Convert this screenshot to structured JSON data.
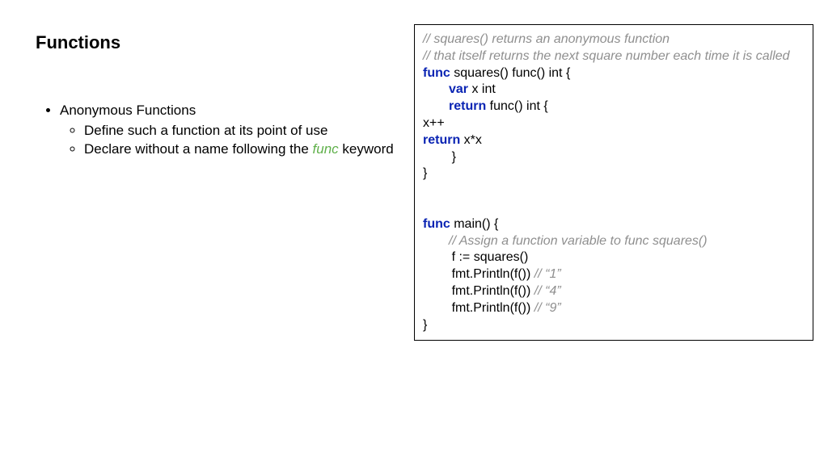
{
  "title": "Functions",
  "bullets": {
    "item1": "Anonymous Functions",
    "sub1": "Define such a function at its point of use",
    "sub2a": "Declare without a name following the ",
    "sub2func": "func",
    "sub2b": " keyword"
  },
  "code": {
    "c1": "// squares() returns an anonymous function",
    "c2": "// that itself returns the next square number each time it is called",
    "kw_func": "func",
    "l3a": " squares() func() int {",
    "kw_var": "var",
    "l4a": " x int",
    "kw_return": "return",
    "l5a": " func() int {",
    "l6": "x++",
    "l7a": " x*x",
    "l8": "        }",
    "l9": "}",
    "l10a": " main() {",
    "c3": "// Assign a function variable to func squares()",
    "l12": "        f := squares()",
    "l13a": "        fmt.Println(f()) ",
    "c4": "// “1”",
    "l14a": "        fmt.Println(f()) ",
    "c5": "// “4”",
    "l15a": "        fmt.Println(f()) ",
    "c6": "// “9”",
    "l16": "}"
  }
}
